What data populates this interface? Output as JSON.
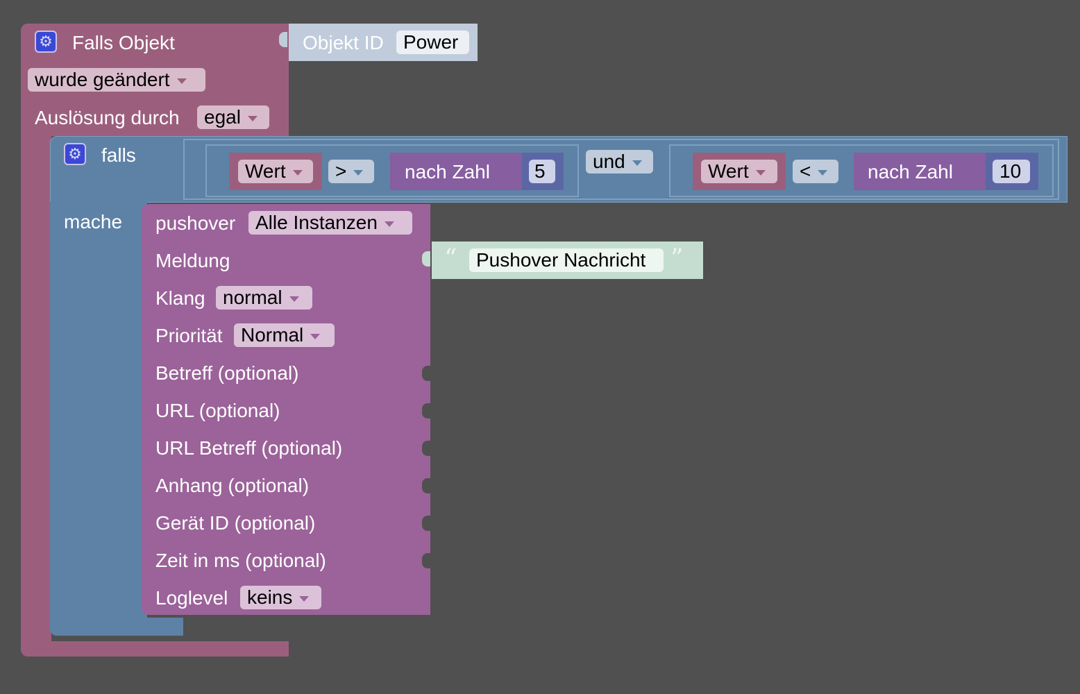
{
  "trigger": {
    "title": "Falls Objekt",
    "event": "wurde geändert",
    "trigger_label": "Auslösung durch",
    "trigger_value": "egal",
    "object_label": "Objekt ID",
    "object_value": "Power"
  },
  "if_block": {
    "label": "falls",
    "do_label": "mache",
    "operator": "und",
    "left": {
      "value_field": "Wert",
      "op": ">",
      "num_label": "nach Zahl",
      "num": "5"
    },
    "right": {
      "value_field": "Wert",
      "op": "<",
      "num_label": "nach Zahl",
      "num": "10"
    }
  },
  "pushover": {
    "label": "pushover",
    "instance": "Alle Instanzen",
    "message_label": "Meldung",
    "message_value": "Pushover Nachricht",
    "quote_open": "“",
    "quote_close": "”",
    "sound_label": "Klang",
    "sound_value": "normal",
    "priority_label": "Priorität",
    "priority_value": "Normal",
    "optional": [
      "Betreff (optional)",
      "URL (optional)",
      "URL Betreff (optional)",
      "Anhang (optional)",
      "Gerät ID (optional)",
      "Zeit in ms (optional)"
    ],
    "loglevel_label": "Loglevel",
    "loglevel_value": "keins"
  },
  "colors": {
    "background": "#505050",
    "event": "#9b5f7d",
    "logic": "#5e82a6",
    "pushover": "#9b6399",
    "math": "#875ea0",
    "number": "#5b67a5",
    "text": "#c4ddd0"
  }
}
